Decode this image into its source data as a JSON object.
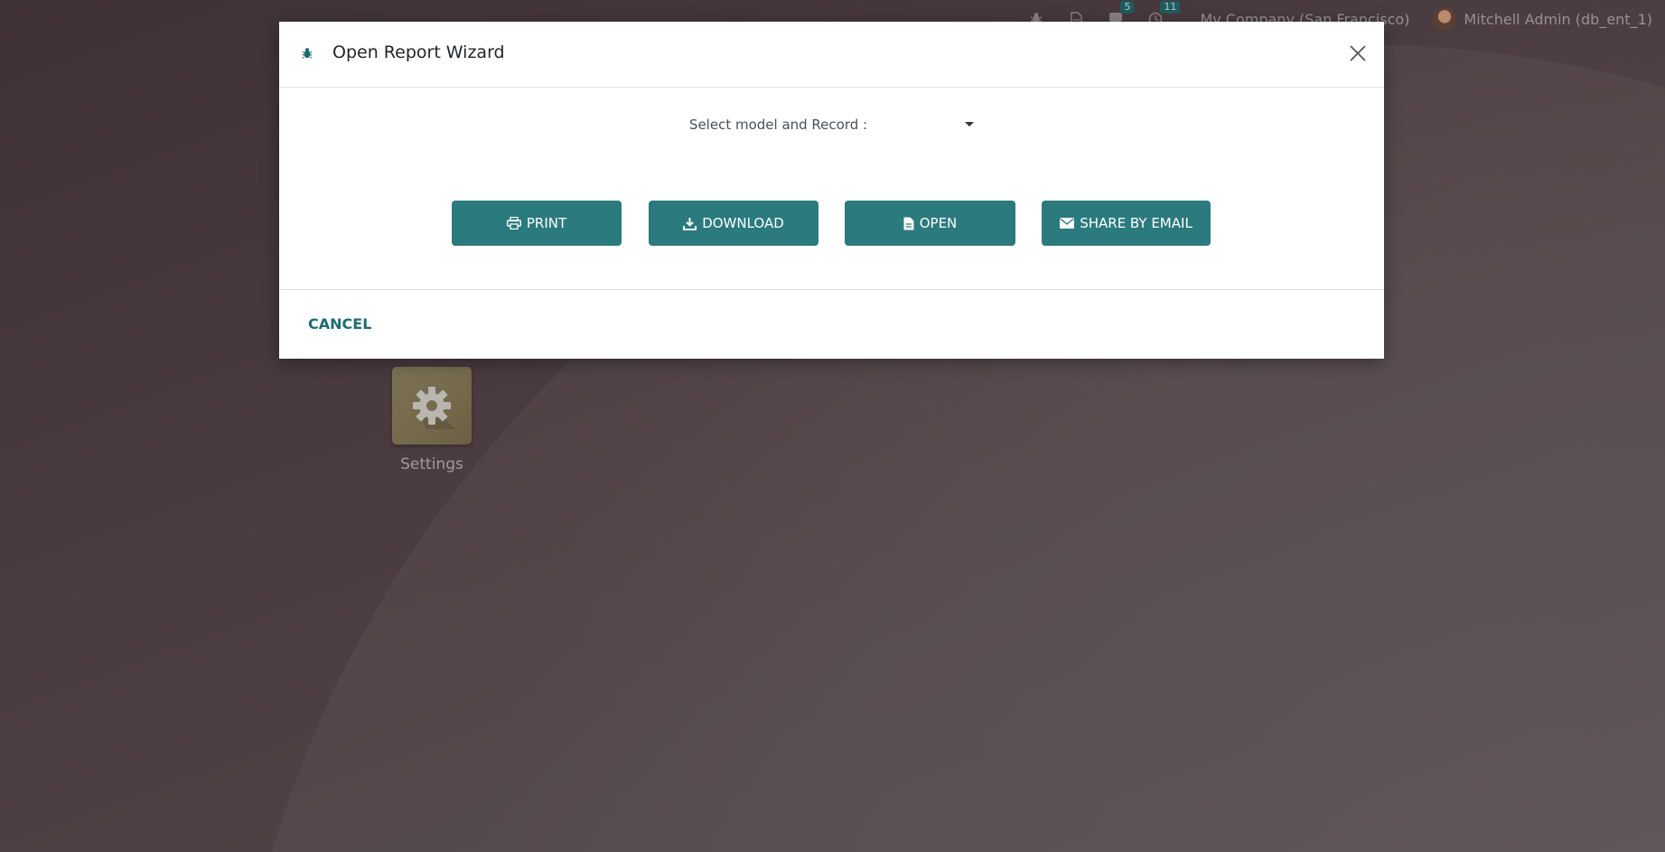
{
  "navbar": {
    "chat_count": "5",
    "activity_count": "11",
    "company": "My Company (San Francisco)",
    "user": "Mitchell Admin (db_ent_1)"
  },
  "apps": [
    {
      "label": "Settings",
      "icon": "gear-icon"
    }
  ],
  "modal": {
    "title": "Open Report Wizard",
    "select_label": "Select model and Record :",
    "select_value": "",
    "buttons": {
      "print": "PRINT",
      "download": "DOWNLOAD",
      "open": "OPEN",
      "share": "SHARE BY EMAIL"
    },
    "cancel": "CANCEL"
  },
  "colors": {
    "primary": "#2b7a7e",
    "cancel_text": "#1f6b70",
    "background": "#4a3e42"
  }
}
